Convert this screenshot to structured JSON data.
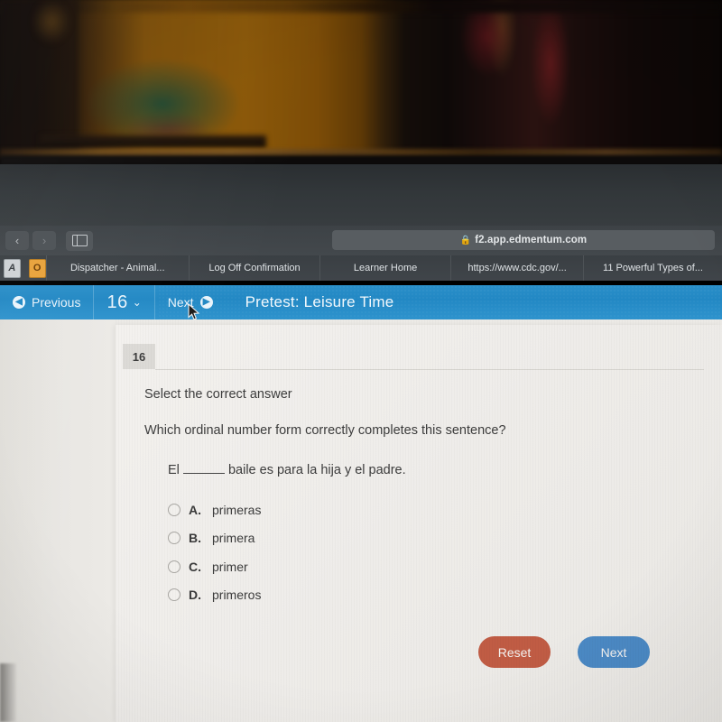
{
  "browser": {
    "back_icon": "‹",
    "forward_icon": "›",
    "sidebar_icon": "sidebar-icon",
    "lock_icon": "🔒",
    "url": "f2.app.edmentum.com",
    "favicons": [
      {
        "name": "favicon-a",
        "glyph": "A"
      },
      {
        "name": "favicon-o",
        "glyph": "O"
      }
    ],
    "bookmarks": [
      {
        "label": "Dispatcher - Animal..."
      },
      {
        "label": "Log Off Confirmation"
      },
      {
        "label": "Learner Home"
      },
      {
        "label": "https://www.cdc.gov/..."
      },
      {
        "label": "11 Powerful Types of..."
      }
    ]
  },
  "appnav": {
    "previous_label": "Previous",
    "previous_icon": "◀",
    "question_number": "16",
    "chevron_icon": "⌄",
    "next_label": "Next",
    "next_icon": "▶",
    "title": "Pretest: Leisure Time"
  },
  "question": {
    "number": "16",
    "instruction": "Select the correct answer",
    "prompt": "Which ordinal number form correctly completes this sentence?",
    "sentence_before": "El",
    "sentence_after": "baile es para la hija y el padre.",
    "options": [
      {
        "letter": "A.",
        "label": "primeras",
        "selected": false
      },
      {
        "letter": "B.",
        "label": "primera",
        "selected": false
      },
      {
        "letter": "C.",
        "label": "primer",
        "selected": false
      },
      {
        "letter": "D.",
        "label": "primeros",
        "selected": false
      }
    ]
  },
  "actions": {
    "reset_label": "Reset",
    "next_label": "Next"
  },
  "colors": {
    "nav_blue": "#2288c4",
    "reset_red": "#c05c44",
    "next_blue": "#4b89c4",
    "chrome_gray": "#3d4246"
  }
}
